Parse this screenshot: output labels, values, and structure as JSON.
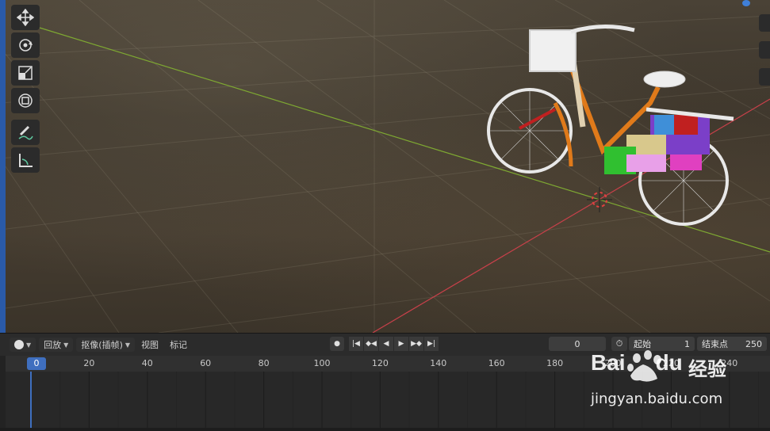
{
  "timeline": {
    "editor_icon": "clock-editor-icon",
    "playback_label": "回放",
    "keying_label": "抠像(插帧)",
    "view_label": "视图",
    "marker_label": "标记",
    "current_frame": "0",
    "start_label": "起始",
    "start_value": "1",
    "end_label": "结束点",
    "end_value": "250",
    "ruler_current": "0",
    "ruler_ticks": [
      "20",
      "40",
      "60",
      "80",
      "100",
      "120",
      "140",
      "160",
      "180",
      "200",
      "220",
      "240"
    ]
  },
  "watermark": {
    "brand_text": "Bai",
    "brand_suffix": "du",
    "cn_text": "经验",
    "url": "jingyan.baidu.com"
  },
  "colors": {
    "accent": "#3f6fbf",
    "x_axis": "#c8404a",
    "y_axis": "#7ea832"
  }
}
